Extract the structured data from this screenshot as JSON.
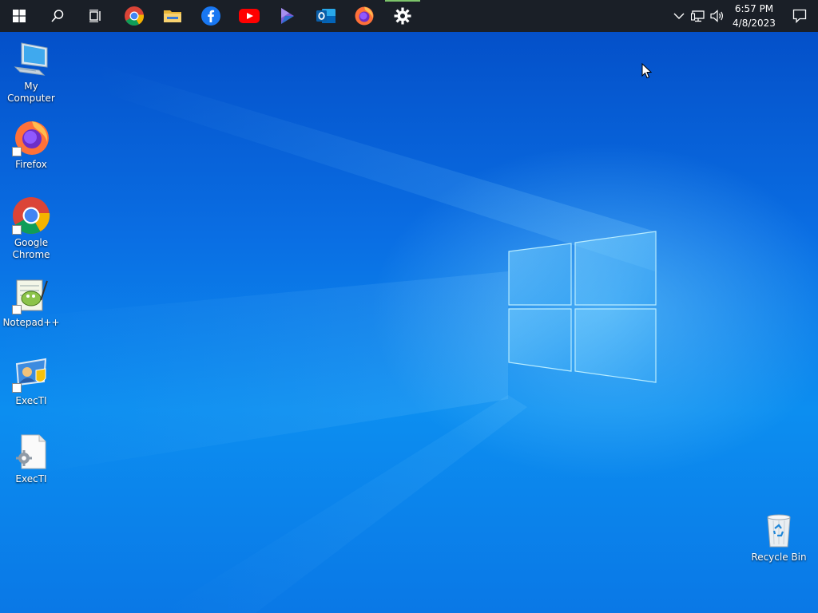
{
  "taskbar": {
    "start": {
      "icon": "windows-logo-icon"
    },
    "pinned": [
      {
        "name": "search",
        "icon": "search-icon"
      },
      {
        "name": "task-view",
        "icon": "task-view-icon"
      },
      {
        "name": "chrome",
        "icon": "chrome-icon"
      },
      {
        "name": "file-explorer",
        "icon": "folder-icon"
      },
      {
        "name": "facebook",
        "icon": "facebook-icon"
      },
      {
        "name": "youtube",
        "icon": "youtube-icon"
      },
      {
        "name": "power-automate",
        "icon": "power-automate-icon"
      },
      {
        "name": "outlook",
        "icon": "outlook-icon"
      },
      {
        "name": "firefox",
        "icon": "firefox-icon"
      },
      {
        "name": "settings",
        "icon": "gear-icon",
        "active": true
      }
    ],
    "tray": {
      "icons": [
        "chevron-up-icon",
        "network-icon",
        "volume-icon"
      ],
      "time": "6:57 PM",
      "date": "4/8/2023",
      "notification_icon": "action-center-icon"
    }
  },
  "desktop": {
    "icons": [
      {
        "label": "My Computer",
        "icon": "computer-icon"
      },
      {
        "label": "Firefox",
        "icon": "firefox-icon"
      },
      {
        "label": "Google Chrome",
        "icon": "chrome-icon"
      },
      {
        "label": "Notepad++",
        "icon": "notepadpp-icon"
      },
      {
        "label": "ExecTI",
        "icon": "execti-icon"
      },
      {
        "label": "ExecTI",
        "icon": "file-gear-icon"
      },
      {
        "label": "Recycle Bin",
        "icon": "recycle-bin-icon"
      }
    ]
  },
  "colors": {
    "taskbar": "#1a1f27",
    "wallpaper": "#0a6ee3",
    "active_indicator": "#7cc46a"
  }
}
